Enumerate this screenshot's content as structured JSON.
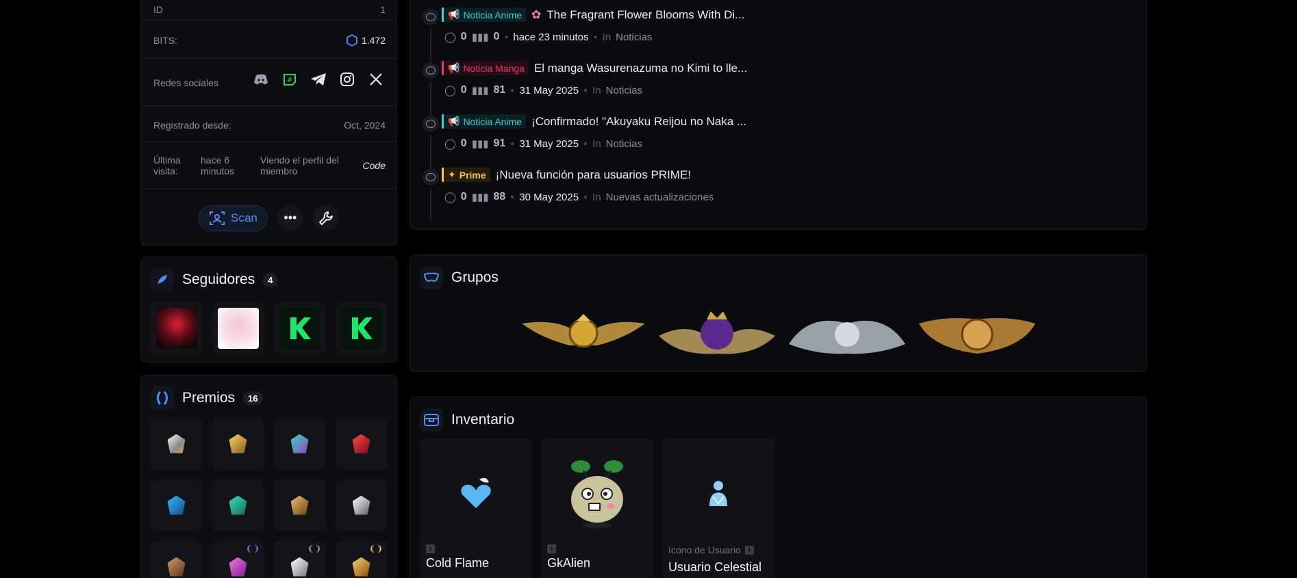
{
  "profile": {
    "id_label": "ID",
    "id_value": "1",
    "bits_label": "BITS:",
    "bits_value": "1.472",
    "social_label": "Redes sociales",
    "registered_label": "Registrado desde:",
    "registered_value": "Oct, 2024",
    "last_visit_label": "Última visita:",
    "last_visit_time": "hace 6 minutos",
    "last_visit_activity": "Viendo el perfil del miembro",
    "last_visit_code": "Code",
    "scan_label": "Scan",
    "more_label": "•••"
  },
  "followers": {
    "title": "Seguidores",
    "count": "4"
  },
  "awards": {
    "title": "Premios",
    "count": "16"
  },
  "activity": [
    {
      "tag": "Noticia Anime",
      "tag_color": "#2fd3d0",
      "title": "The Fragrant Flower Blooms With Di...",
      "comments": "0",
      "views": "0",
      "date": "hace 23 minutos",
      "in": "In",
      "forum": "Noticias"
    },
    {
      "tag": "Noticia Manga",
      "tag_color": "#e9366a",
      "title": "El manga Wasurenazuma no Kimi to lle...",
      "comments": "0",
      "views": "81",
      "date": "31 May 2025",
      "in": "In",
      "forum": "Noticias"
    },
    {
      "tag": "Noticia Anime",
      "tag_color": "#2fd3d0",
      "title": "¡Confirmado! \"Akuyaku Reijou no Naka ...",
      "comments": "0",
      "views": "91",
      "date": "31 May 2025",
      "in": "In",
      "forum": "Noticias"
    },
    {
      "tag": "Prime",
      "tag_color": "#f3c343",
      "title": "¡Nueva función para usuarios PRIME!",
      "comments": "0",
      "views": "88",
      "date": "30 May 2025",
      "in": "In",
      "forum": "Nuevas actualizaciones"
    }
  ],
  "groups": {
    "title": "Grupos"
  },
  "inventory": {
    "title": "Inventario",
    "items": [
      {
        "type": "",
        "name": "Cold Flame"
      },
      {
        "type": "",
        "name": "GkAlien"
      },
      {
        "type": "Icono de Usuario",
        "name": "Usuario Celestial"
      }
    ]
  },
  "colors": {
    "accent": "#4e8ff0",
    "background": "#000000",
    "panel": "#0d0e12"
  }
}
